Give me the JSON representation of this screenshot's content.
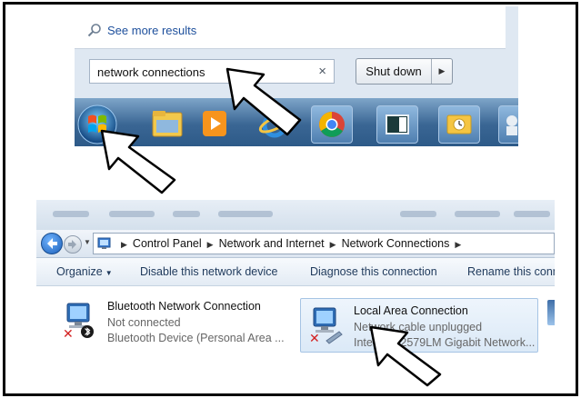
{
  "start_menu": {
    "see_more": "See more results",
    "search_value": "network connections",
    "clear_glyph": "×",
    "shutdown_label": "Shut down",
    "shutdown_arrow_glyph": "▶"
  },
  "taskbar": {
    "icons": [
      "windows-start-orb-icon",
      "file-explorer-icon",
      "media-player-icon",
      "internet-explorer-icon",
      "chrome-icon",
      "app-window-icon",
      "outlook-icon",
      "partial-icon"
    ]
  },
  "explorer": {
    "breadcrumbs": [
      "Control Panel",
      "Network and Internet",
      "Network Connections"
    ],
    "crumb_sep": "▶",
    "toolbar": {
      "organize": "Organize",
      "organize_caret": "▼",
      "disable": "Disable this network device",
      "diagnose": "Diagnose this connection",
      "rename": "Rename this conn"
    },
    "connections": [
      {
        "name": "Bluetooth Network Connection",
        "status": "Not connected",
        "device": "Bluetooth Device (Personal Area ..."
      },
      {
        "name": "Local Area Connection",
        "status": "Network cable unplugged",
        "device": "Intel(R) 82579LM Gigabit Network..."
      }
    ]
  },
  "colors": {
    "frame": "#000000",
    "link_blue": "#1d4f9c",
    "taskbar_blue": "#3a6694",
    "toolbar_text": "#1e395b",
    "error_red": "#d32020"
  }
}
